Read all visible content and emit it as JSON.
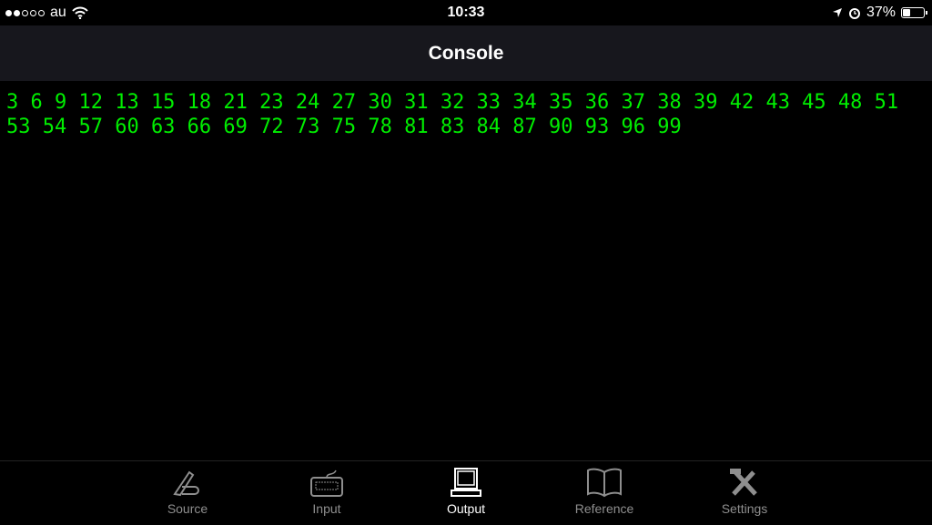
{
  "status_bar": {
    "signal_strength": 2,
    "signal_max": 5,
    "carrier": "au",
    "time": "10:33",
    "battery": "37%",
    "battery_level": 0.37
  },
  "navbar": {
    "title": "Console"
  },
  "console": {
    "text_color": "#00ee00",
    "output": "3 6 9 12 13 15 18 21 23 24 27 30 31 32 33 34 35 36 37 38 39 42 43 45 48 51 53 54 57 60 63 66 69 72 73 75 78 81 83 84 87 90 93 96 99"
  },
  "tabbar": {
    "items": [
      {
        "label": "Source",
        "icon": "pen-hand-icon"
      },
      {
        "label": "Input",
        "icon": "keyboard-icon"
      },
      {
        "label": "Output",
        "icon": "computer-icon",
        "active": true
      },
      {
        "label": "Reference",
        "icon": "book-icon"
      },
      {
        "label": "Settings",
        "icon": "tools-icon"
      }
    ]
  }
}
